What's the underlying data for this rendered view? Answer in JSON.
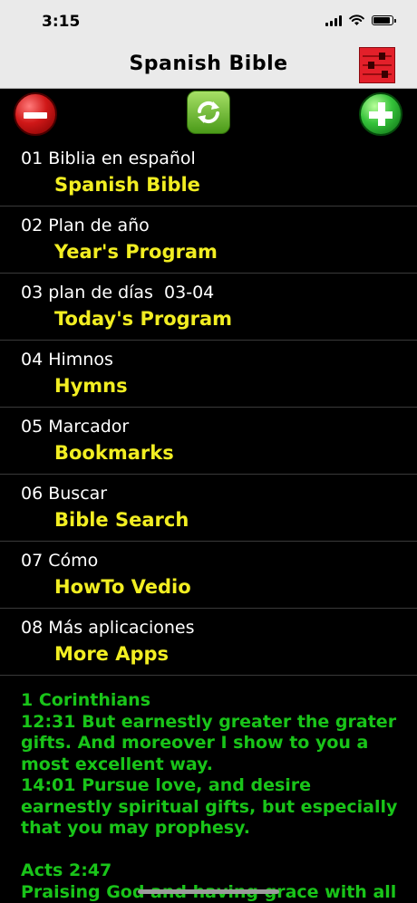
{
  "status_bar": {
    "time": "3:15"
  },
  "nav": {
    "title": "Spanish Bible",
    "settings_icon": "sliders-icon",
    "settings_color": "#e3202a"
  },
  "toolbar": {
    "remove_icon": "minus-circle-icon",
    "refresh_icon": "refresh-icon",
    "add_icon": "plus-circle-icon"
  },
  "menu": {
    "items": [
      {
        "label": "01 Biblia en español",
        "sublabel": "Spanish Bible"
      },
      {
        "label": "02 Plan de año",
        "sublabel": "Year's Program"
      },
      {
        "label": "03 plan de días  03-04",
        "sublabel": "Today's Program"
      },
      {
        "label": "04 Himnos",
        "sublabel": "Hymns"
      },
      {
        "label": "05 Marcador",
        "sublabel": "Bookmarks"
      },
      {
        "label": "06 Buscar",
        "sublabel": "Bible Search"
      },
      {
        "label": "07 Cómo",
        "sublabel": "HowTo Vedio"
      },
      {
        "label": "08 Más aplicaciones",
        "sublabel": "More Apps"
      }
    ]
  },
  "verse": {
    "text": "1 Corinthians\n12:31 But earnestly greater the grater gifts. And moreover I show to you a most excellent  way.\n14:01 Pursue love, and desire earnestly spiritual gifts, but especially that you may prophesy.\n\nActs 2:47\nPraising God and having grace with all"
  },
  "colors": {
    "label": "#ffffff",
    "sublabel": "#f2ee22",
    "verse": "#19c419",
    "background": "#000000"
  }
}
